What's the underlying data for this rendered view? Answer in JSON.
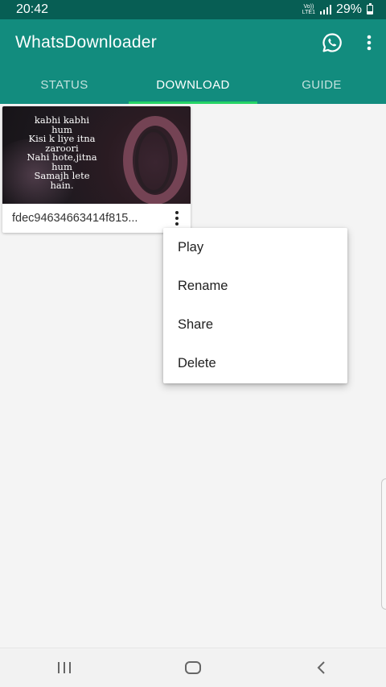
{
  "status_bar": {
    "time": "20:42",
    "network_label_top": "Vo))",
    "network_label_bottom": "LTE1",
    "battery": "29%"
  },
  "app_bar": {
    "title": "WhatsDownloader",
    "whatsapp_icon": "whatsapp-icon",
    "overflow_icon": "more-vert-icon"
  },
  "tabs": [
    {
      "label": "STATUS",
      "active": false
    },
    {
      "label": "DOWNLOAD",
      "active": true
    },
    {
      "label": "GUIDE",
      "active": false
    }
  ],
  "card": {
    "quote_lines": [
      "kabhi kabhi",
      "hum",
      "Kisi k liye itna",
      "zaroori",
      "Nahi hote,jitna",
      "hum",
      "Samajh lete",
      "hain."
    ],
    "filename": "fdec94634663414f815..."
  },
  "context_menu": {
    "items": [
      "Play",
      "Rename",
      "Share",
      "Delete"
    ]
  },
  "nav_bar": {
    "recents_icon": "recents-icon",
    "home_icon": "home-icon",
    "back_icon": "back-icon"
  },
  "colors": {
    "status_bar": "#075e54",
    "app_bar": "#128c7e",
    "tab_indicator": "#25d366"
  }
}
